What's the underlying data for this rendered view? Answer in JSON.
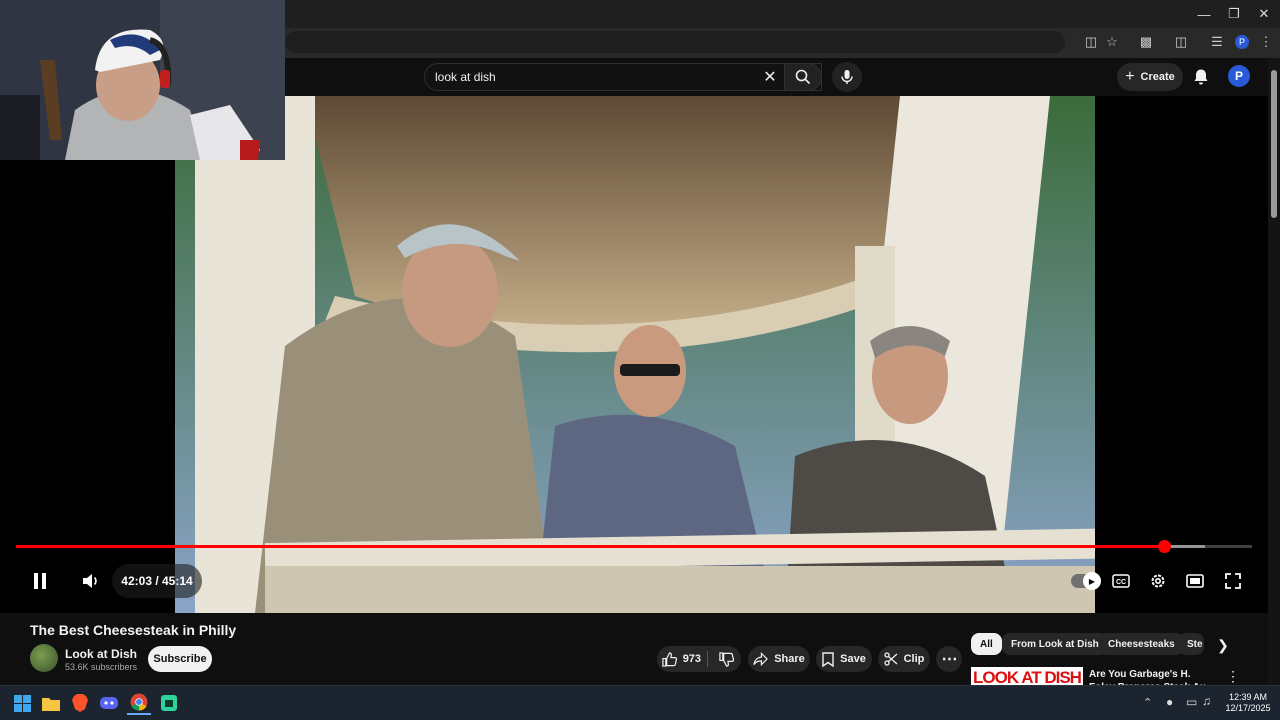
{
  "search": {
    "query": "look at dish"
  },
  "header": {
    "create_label": "Create",
    "avatar_letter": "P"
  },
  "player": {
    "current_time": "42:03",
    "duration": "45:14",
    "time_display": "42:03 / 45:14",
    "progress_fraction": 0.929,
    "buffered_fraction": 0.962,
    "playing": true
  },
  "video": {
    "title": "The Best Cheesesteak in Philly",
    "channel": "Look at Dish",
    "subscribers": "53.6K subscribers",
    "subscribe_label": "Subscribe",
    "likes": "973",
    "share_label": "Share",
    "save_label": "Save",
    "clip_label": "Clip"
  },
  "chips": [
    "All",
    "From Look at Dish",
    "Cheesesteaks",
    "Ste"
  ],
  "recommendation": {
    "thumb_text": "LOOK AT DISH",
    "title": "Are You Garbage's H. Foley Prepares Steak Au Poivre - Lo"
  },
  "taskbar": {
    "time": "12:39 AM",
    "date": "12/17/2025"
  },
  "colors": {
    "accent": "#ff0000",
    "background": "#0f0f0f",
    "chip_active": "#f1f1f1",
    "avatar": "#2a5bd7"
  },
  "icons": [
    "minimize-icon",
    "maximize-icon",
    "close-icon",
    "search-icon",
    "mic-icon",
    "plus-icon",
    "bell-icon",
    "pause-icon",
    "volume-icon",
    "autoplay-toggle",
    "captions-icon",
    "settings-icon",
    "theater-icon",
    "fullscreen-icon",
    "thumbs-up-icon",
    "thumbs-down-icon",
    "share-icon",
    "save-icon",
    "clip-icon",
    "more-icon",
    "chevron-right-icon"
  ]
}
